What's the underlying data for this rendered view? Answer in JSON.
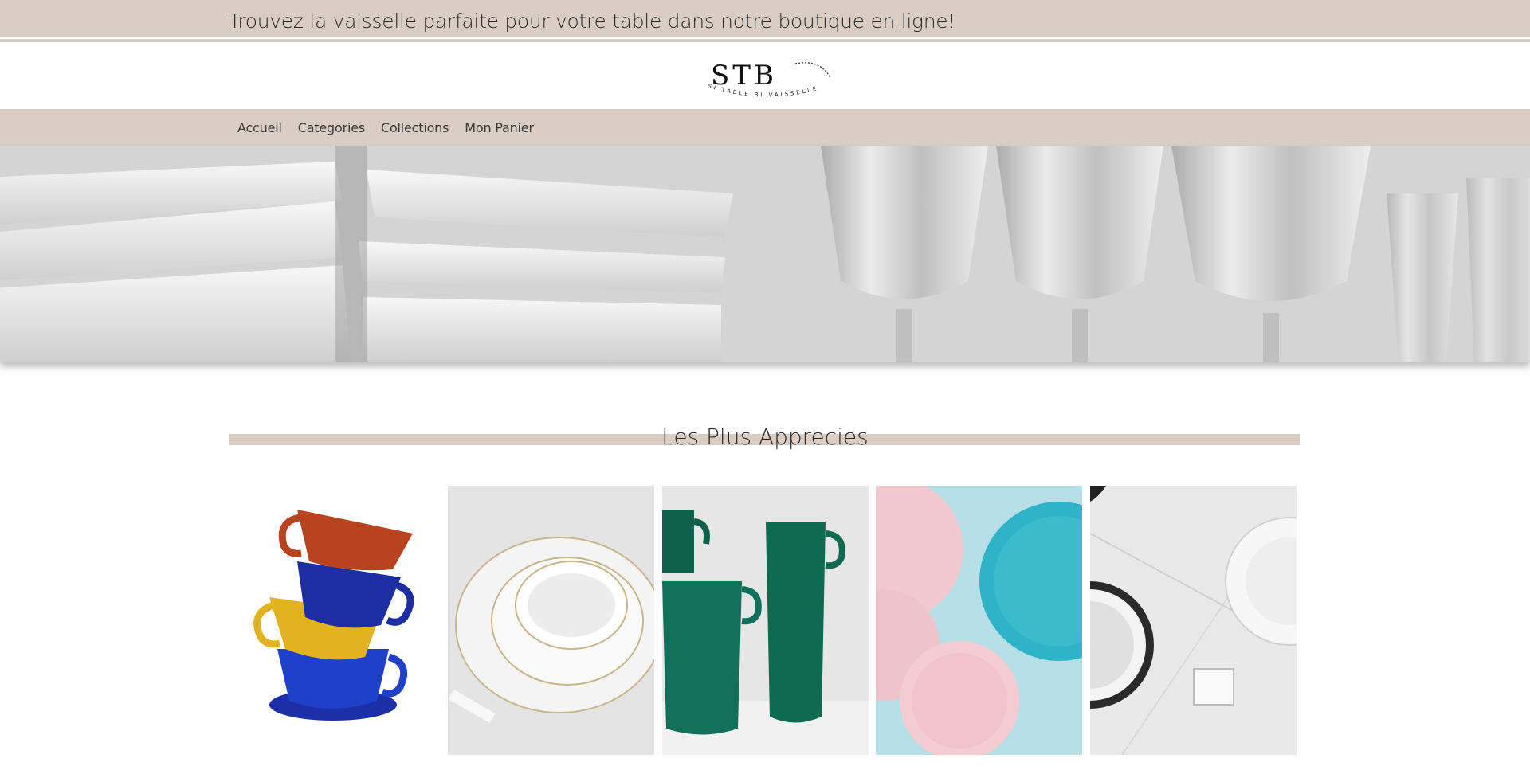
{
  "banner": {
    "tagline": "Trouvez la vaisselle parfaite pour votre table dans notre boutique en ligne!"
  },
  "logo": {
    "monogram": "STB",
    "subtitle": "SI TABLE BI VAISSELLES"
  },
  "nav": {
    "items": [
      "Accueil",
      "Categories",
      "Collections",
      "Mon Panier"
    ]
  },
  "section": {
    "title": "Les Plus Apprecies"
  },
  "colors": {
    "beige": "#dacdc4",
    "text": "#2a2a2a"
  },
  "products": [
    {
      "name": "stacked-colored-cups"
    },
    {
      "name": "white-porcelain-set"
    },
    {
      "name": "green-mugs"
    },
    {
      "name": "pink-and-teal-plates"
    },
    {
      "name": "marble-white-dishes"
    }
  ]
}
